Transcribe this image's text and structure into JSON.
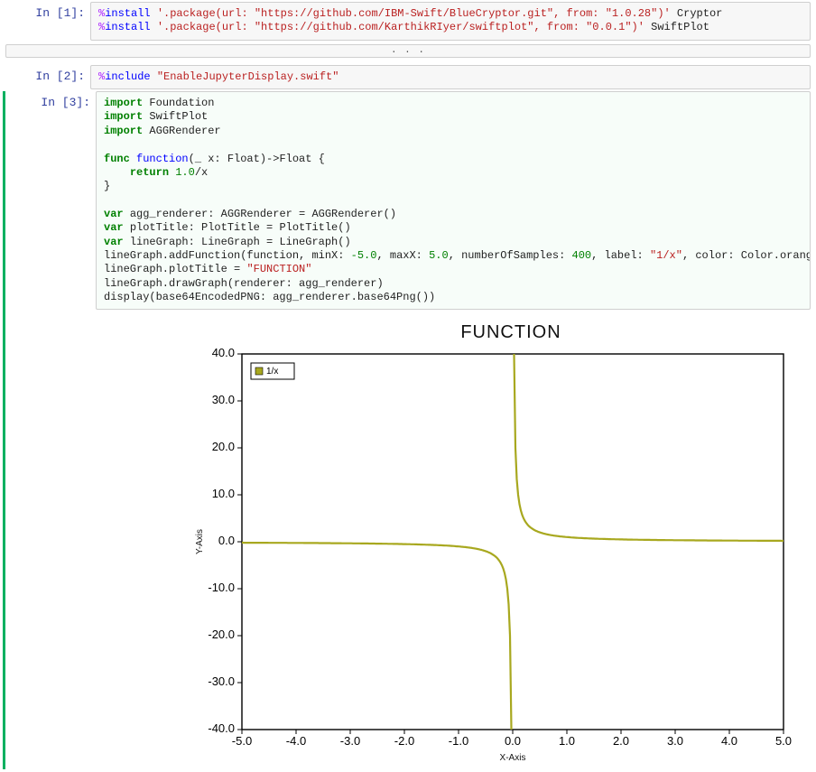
{
  "cells": {
    "c1_prompt": "In [1]:",
    "c2_prompt": "In [2]:",
    "c3_prompt": "In [3]:",
    "c1_pct1": "%",
    "c1_install1": "install",
    "c1_pkgstr1": "'.package(url: \"https://github.com/IBM-Swift/BlueCryptor.git\", from: \"1.0.28\")'",
    "c1_tail1": " Cryptor",
    "c1_pct2": "%",
    "c1_install2": "install",
    "c1_pkgstr2": "'.package(url: \"https://github.com/KarthikRIyer/swiftplot\", from: \"0.0.1\")'",
    "c1_tail2": " SwiftPlot",
    "collapsed_dots": ". . .",
    "c2_pct": "%",
    "c2_incl": "include",
    "c2_str": "\"EnableJupyterDisplay.swift\"",
    "c3_imp1a": "import ",
    "c3_imp1b": "Foundation",
    "c3_imp2a": "import ",
    "c3_imp2b": "SwiftPlot",
    "c3_imp3a": "import ",
    "c3_imp3b": "AGGRenderer",
    "c3_funca": "func ",
    "c3_funcb": "function",
    "c3_func_rest": "(_ x: Float)->Float {",
    "c3_ret_a": "    ",
    "c3_ret_b": "return ",
    "c3_ret_c": "1.0",
    "c3_ret_d": "/x",
    "c3_close": "}",
    "c3_var1a": "var ",
    "c3_var1b": "agg_renderer: AGGRenderer = AGGRenderer()",
    "c3_var2a": "var ",
    "c3_var2b": "plotTitle: PlotTitle = PlotTitle()",
    "c3_var3a": "var ",
    "c3_var3b": "lineGraph: LineGraph = LineGraph()",
    "c3_add_a": "lineGraph.addFunction(function, minX: ",
    "c3_add_b": "-5.0",
    "c3_add_c": ", maxX: ",
    "c3_add_d": "5.0",
    "c3_add_e": ", numberOfSamples: ",
    "c3_add_f": "400",
    "c3_add_g": ", label: ",
    "c3_add_h": "\"1/x\"",
    "c3_add_i": ", color: Color.orange)",
    "c3_title_a": "lineGraph.plotTitle = ",
    "c3_title_b": "\"FUNCTION\"",
    "c3_draw": "lineGraph.drawGraph(renderer: agg_renderer)",
    "c3_disp": "display(base64EncodedPNG: agg_renderer.base64Png())"
  },
  "chart_data": {
    "type": "line",
    "title": "FUNCTION",
    "xlabel": "X-Axis",
    "ylabel": "Y-Axis",
    "xlim": [
      -5.0,
      5.0
    ],
    "ylim": [
      -40.0,
      40.0
    ],
    "xticks": [
      -5.0,
      -4.0,
      -3.0,
      -2.0,
      -1.0,
      0.0,
      1.0,
      2.0,
      3.0,
      4.0,
      5.0
    ],
    "yticks": [
      -40.0,
      -30.0,
      -20.0,
      -10.0,
      0.0,
      10.0,
      20.0,
      30.0,
      40.0
    ],
    "series": [
      {
        "name": "1/x",
        "color": "#a8a81f",
        "function": "1/x",
        "samples": 400
      }
    ],
    "legend_position": "top-left"
  }
}
